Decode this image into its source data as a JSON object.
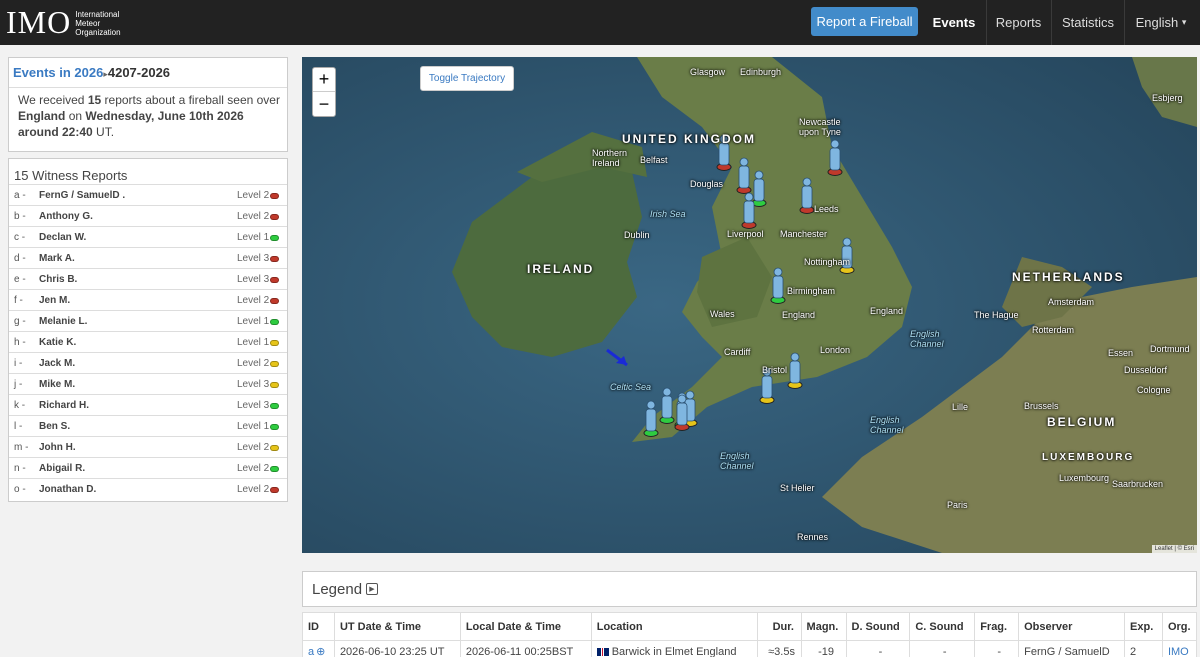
{
  "brand": {
    "logo_text": "IMO",
    "logo_subtitle_1": "International",
    "logo_subtitle_2": "Meteor",
    "logo_subtitle_3": "Organization"
  },
  "nav": {
    "report_button": "Report a Fireball",
    "events": "Events",
    "reports": "Reports",
    "statistics": "Statistics",
    "language": "English",
    "language_caret": "▾"
  },
  "event": {
    "year_link": "Events in 2026",
    "event_id": "4207-2026",
    "text_1": "We received",
    "count": "15",
    "text_2": "reports about a fireball seen over",
    "region": "England",
    "text_3": "on",
    "date": "Wednesday, June 10th 2026 around 22:40",
    "text_4": "UT."
  },
  "witness": {
    "title": "15 Witness Reports",
    "items": [
      {
        "id": "a -",
        "name": "FernG / SamuelD .",
        "level": "Level 2",
        "color": "#c0392b"
      },
      {
        "id": "b -",
        "name": "Anthony G.",
        "level": "Level 2",
        "color": "#c0392b"
      },
      {
        "id": "c -",
        "name": "Declan W.",
        "level": "Level 1",
        "color": "#2ecc40"
      },
      {
        "id": "d -",
        "name": "Mark A.",
        "level": "Level 3",
        "color": "#c0392b"
      },
      {
        "id": "e -",
        "name": "Chris B.",
        "level": "Level 3",
        "color": "#c0392b"
      },
      {
        "id": "f -",
        "name": "Jen M.",
        "level": "Level 2",
        "color": "#c0392b"
      },
      {
        "id": "g -",
        "name": "Melanie L.",
        "level": "Level 1",
        "color": "#2ecc40"
      },
      {
        "id": "h -",
        "name": "Katie  K.",
        "level": "Level 1",
        "color": "#e6c419"
      },
      {
        "id": "i -",
        "name": "Jack M.",
        "level": "Level 2",
        "color": "#e6c419"
      },
      {
        "id": "j -",
        "name": "Mike M.",
        "level": "Level 3",
        "color": "#e6c419"
      },
      {
        "id": "k -",
        "name": "Richard H.",
        "level": "Level 3",
        "color": "#2ecc40"
      },
      {
        "id": "l -",
        "name": "Ben S.",
        "level": "Level 1",
        "color": "#2ecc40"
      },
      {
        "id": "m -",
        "name": "John H.",
        "level": "Level 2",
        "color": "#e6c419"
      },
      {
        "id": "n -",
        "name": "Abigail R.",
        "level": "Level 2",
        "color": "#2ecc40"
      },
      {
        "id": "o -",
        "name": "Jonathan  D.",
        "level": "Level 2",
        "color": "#c0392b"
      }
    ]
  },
  "map": {
    "zoom_in": "+",
    "zoom_out": "−",
    "toggle_trajectory": "Toggle Trajectory",
    "attribution": "Leaflet | © Esri",
    "labels": {
      "uk": "UNITED KINGDOM",
      "ireland": "IRELAND",
      "netherlands": "NETHERLANDS",
      "belgium": "BELGIUM",
      "luxembourg": "LUXEMBOURG",
      "glasgow": "Glasgow",
      "edinburgh": "Edinburgh",
      "newcastle": "Newcastle upon Tyne",
      "northern_ireland": "Northern Ireland",
      "belfast": "Belfast",
      "douglas": "Douglas",
      "irish_sea": "Irish Sea",
      "dublin": "Dublin",
      "liverpool": "Liverpool",
      "manchester": "Manchester",
      "leeds": "Leeds",
      "nottingham": "Nottingham",
      "birmingham": "Birmingham",
      "wales": "Wales",
      "england": "England",
      "england2": "England",
      "cardiff": "Cardiff",
      "london": "London",
      "bristol": "Bristol",
      "english_channel": "English Channel",
      "english_channel2": "English Channel",
      "celtic_sea": "Celtic Sea",
      "st_helier": "St Helier",
      "rennes": "Rennes",
      "paris": "Paris",
      "amsterdam": "Amsterdam",
      "the_hague": "The Hague",
      "rotterdam": "Rotterdam",
      "essen": "Essen",
      "dortmund": "Dortmund",
      "dusseldorf": "Dusseldorf",
      "cologne": "Cologne",
      "brussels": "Brussels",
      "lille": "Lille",
      "luxembourg_city": "Luxembourg",
      "saarbrucken": "Saarbrucken",
      "esbjerg": "Esbjerg"
    }
  },
  "legend": {
    "title": "Legend",
    "icon": "▶"
  },
  "table": {
    "headers": [
      "ID",
      "UT Date & Time",
      "Local Date & Time",
      "Location",
      "Dur.",
      "Magn.",
      "D. Sound",
      "C. Sound",
      "Frag.",
      "Observer",
      "Exp.",
      "Org."
    ],
    "row": {
      "id": "a",
      "id_icon": "⊕",
      "ut": "2026-06-10 23:25 UT",
      "local": "2026-06-11 00:25BST",
      "location": "Barwick in Elmet England",
      "dur": "≈3.5s",
      "magn": "-19",
      "d_sound": "-",
      "c_sound": "-",
      "frag": "-",
      "observer": "FernG / SamuelD",
      "exp": "2",
      "org": "IMO"
    }
  },
  "colors": {
    "nav_bg": "#222222",
    "accent": "#428bca",
    "link": "#3a7ac2",
    "level_red": "#c0392b",
    "level_green": "#2ecc40",
    "level_yellow": "#e6c419"
  }
}
